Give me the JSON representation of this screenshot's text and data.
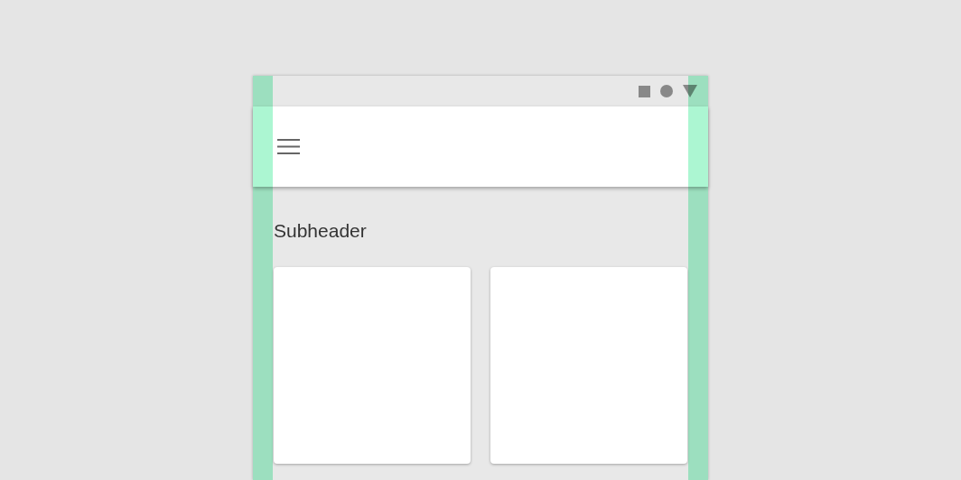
{
  "subheader": "Subheader"
}
